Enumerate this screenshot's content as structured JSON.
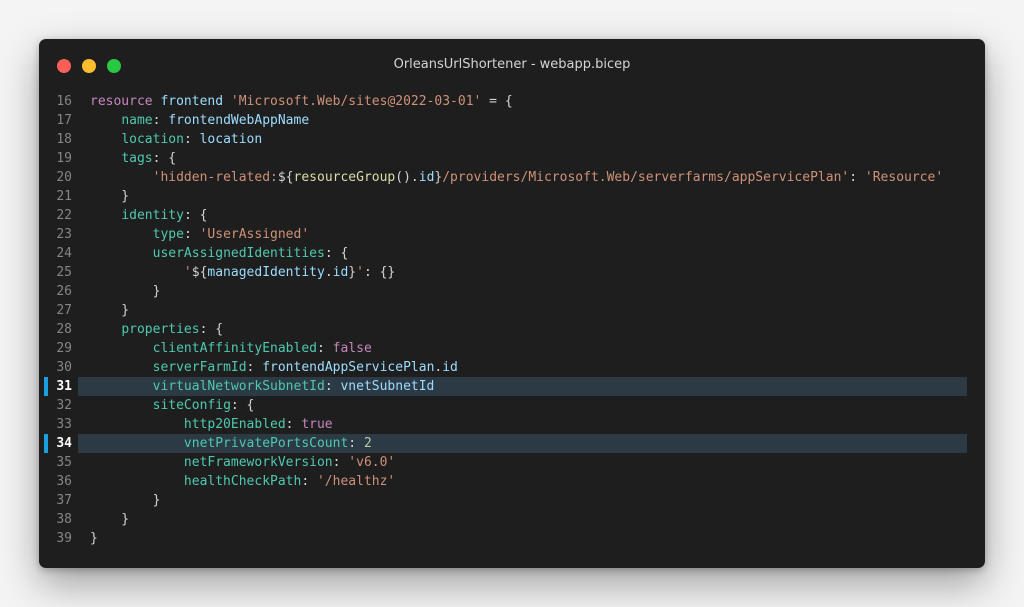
{
  "window": {
    "title": "OrleansUrlShortener - webapp.bicep"
  },
  "editor": {
    "lines": [
      {
        "n": "16",
        "hl": false,
        "tokens": [
          [
            "resource",
            "kw"
          ],
          [
            " ",
            "punc"
          ],
          [
            "frontend",
            "ident"
          ],
          [
            " ",
            "punc"
          ],
          [
            "'Microsoft.Web/sites@2022-03-01'",
            "str"
          ],
          [
            " = {",
            "punc"
          ]
        ]
      },
      {
        "n": "17",
        "hl": false,
        "tokens": [
          [
            "    ",
            "punc"
          ],
          [
            "name",
            "prop"
          ],
          [
            ": ",
            "punc"
          ],
          [
            "frontendWebAppName",
            "ident"
          ]
        ]
      },
      {
        "n": "18",
        "hl": false,
        "tokens": [
          [
            "    ",
            "punc"
          ],
          [
            "location",
            "prop"
          ],
          [
            ": ",
            "punc"
          ],
          [
            "location",
            "ident"
          ]
        ]
      },
      {
        "n": "19",
        "hl": false,
        "tokens": [
          [
            "    ",
            "punc"
          ],
          [
            "tags",
            "prop"
          ],
          [
            ": {",
            "punc"
          ]
        ]
      },
      {
        "n": "20",
        "hl": false,
        "tokens": [
          [
            "        ",
            "punc"
          ],
          [
            "'hidden-related:",
            "str"
          ],
          [
            "${",
            "punc"
          ],
          [
            "resourceGroup",
            "fn"
          ],
          [
            "().",
            "punc"
          ],
          [
            "id",
            "ident"
          ],
          [
            "}",
            "punc"
          ],
          [
            "/providers/Microsoft.Web/serverfarms/appServicePlan'",
            "str"
          ],
          [
            ": ",
            "punc"
          ],
          [
            "'Resource'",
            "str"
          ]
        ]
      },
      {
        "n": "21",
        "hl": false,
        "tokens": [
          [
            "    }",
            "punc"
          ]
        ]
      },
      {
        "n": "22",
        "hl": false,
        "tokens": [
          [
            "    ",
            "punc"
          ],
          [
            "identity",
            "prop"
          ],
          [
            ": {",
            "punc"
          ]
        ]
      },
      {
        "n": "23",
        "hl": false,
        "tokens": [
          [
            "        ",
            "punc"
          ],
          [
            "type",
            "prop"
          ],
          [
            ": ",
            "punc"
          ],
          [
            "'UserAssigned'",
            "str"
          ]
        ]
      },
      {
        "n": "24",
        "hl": false,
        "tokens": [
          [
            "        ",
            "punc"
          ],
          [
            "userAssignedIdentities",
            "prop"
          ],
          [
            ": {",
            "punc"
          ]
        ]
      },
      {
        "n": "25",
        "hl": false,
        "tokens": [
          [
            "            ",
            "punc"
          ],
          [
            "'",
            "str"
          ],
          [
            "${",
            "punc"
          ],
          [
            "managedIdentity",
            "ident"
          ],
          [
            ".",
            "punc"
          ],
          [
            "id",
            "ident"
          ],
          [
            "}",
            "punc"
          ],
          [
            "'",
            "str"
          ],
          [
            ": {}",
            "punc"
          ]
        ]
      },
      {
        "n": "26",
        "hl": false,
        "tokens": [
          [
            "        }",
            "punc"
          ]
        ]
      },
      {
        "n": "27",
        "hl": false,
        "tokens": [
          [
            "    }",
            "punc"
          ]
        ]
      },
      {
        "n": "28",
        "hl": false,
        "tokens": [
          [
            "    ",
            "punc"
          ],
          [
            "properties",
            "prop"
          ],
          [
            ": {",
            "punc"
          ]
        ]
      },
      {
        "n": "29",
        "hl": false,
        "tokens": [
          [
            "        ",
            "punc"
          ],
          [
            "clientAffinityEnabled",
            "prop"
          ],
          [
            ": ",
            "punc"
          ],
          [
            "false",
            "kw"
          ]
        ]
      },
      {
        "n": "30",
        "hl": false,
        "tokens": [
          [
            "        ",
            "punc"
          ],
          [
            "serverFarmId",
            "prop"
          ],
          [
            ": ",
            "punc"
          ],
          [
            "frontendAppServicePlan",
            "ident"
          ],
          [
            ".",
            "punc"
          ],
          [
            "id",
            "ident"
          ]
        ]
      },
      {
        "n": "31",
        "hl": true,
        "tokens": [
          [
            "        ",
            "punc"
          ],
          [
            "virtualNetworkSubnetId",
            "prop"
          ],
          [
            ": ",
            "punc"
          ],
          [
            "vnetSubnetId",
            "ident"
          ]
        ]
      },
      {
        "n": "32",
        "hl": false,
        "tokens": [
          [
            "        ",
            "punc"
          ],
          [
            "siteConfig",
            "prop"
          ],
          [
            ": {",
            "punc"
          ]
        ]
      },
      {
        "n": "33",
        "hl": false,
        "tokens": [
          [
            "            ",
            "punc"
          ],
          [
            "http20Enabled",
            "prop"
          ],
          [
            ": ",
            "punc"
          ],
          [
            "true",
            "kw"
          ]
        ]
      },
      {
        "n": "34",
        "hl": true,
        "tokens": [
          [
            "            ",
            "punc"
          ],
          [
            "vnetPrivatePortsCount",
            "prop"
          ],
          [
            ": ",
            "punc"
          ],
          [
            "2",
            "num"
          ]
        ]
      },
      {
        "n": "35",
        "hl": false,
        "tokens": [
          [
            "            ",
            "punc"
          ],
          [
            "netFrameworkVersion",
            "prop"
          ],
          [
            ": ",
            "punc"
          ],
          [
            "'v6.0'",
            "str"
          ]
        ]
      },
      {
        "n": "36",
        "hl": false,
        "tokens": [
          [
            "            ",
            "punc"
          ],
          [
            "healthCheckPath",
            "prop"
          ],
          [
            ": ",
            "punc"
          ],
          [
            "'/healthz'",
            "str"
          ]
        ]
      },
      {
        "n": "37",
        "hl": false,
        "tokens": [
          [
            "        }",
            "punc"
          ]
        ]
      },
      {
        "n": "38",
        "hl": false,
        "tokens": [
          [
            "    }",
            "punc"
          ]
        ]
      },
      {
        "n": "39",
        "hl": false,
        "tokens": [
          [
            "}",
            "punc"
          ]
        ]
      }
    ]
  },
  "colors": {
    "background": "#1e1e1e",
    "keyword": "#c586c0",
    "identifier": "#9cdcfe",
    "property": "#4ec9b0",
    "string": "#ce9178",
    "function": "#dcdcaa",
    "number": "#b5cea8",
    "highlight": "#2b3a45",
    "highlight_bar": "#1c9fe0"
  }
}
